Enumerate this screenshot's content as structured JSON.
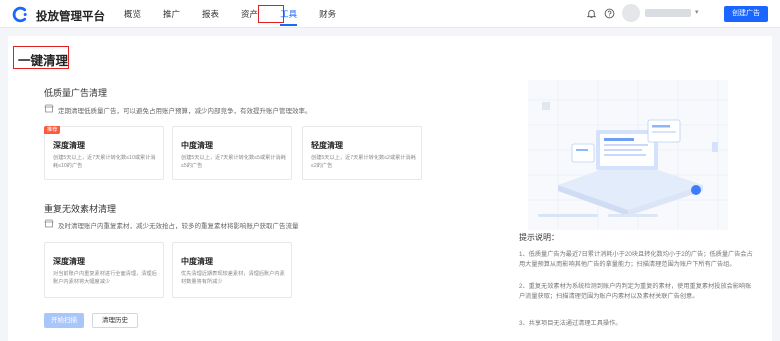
{
  "header": {
    "brand": "投放管理平台",
    "nav": [
      "概览",
      "推广",
      "报表",
      "资产",
      "工具",
      "财务"
    ],
    "active_nav": "工具",
    "icons": [
      "bell-icon",
      "help-icon"
    ],
    "create_button": "创建广告"
  },
  "page": {
    "title": "一键清理"
  },
  "low_quality": {
    "title": "低质量广告清理",
    "desc": "定期清理低质量广告，可以避免占用账户预算，减少内部竞争，有效提升账户管理效率。",
    "cards": [
      {
        "title": "深度清理",
        "badge": "推荐",
        "desc": "创建5天以上，近7天累计转化数≤10或累计消耗≤10的广告"
      },
      {
        "title": "中度清理",
        "desc": "创建5天以上，近7天累计转化数≤5或累计消耗≤5的广告"
      },
      {
        "title": "轻度清理",
        "desc": "创建5天以上，近7天累计转化数≤2或累计消耗≤2的广告"
      }
    ]
  },
  "duplicate": {
    "title": "重复无效素材清理",
    "desc": "及时清理账户内重复素材，减少无效抢占，较多的重复素材将影响账户获取广告流量",
    "cards": [
      {
        "title": "深度清理",
        "desc": "对当前账户内重复素材进行全面清理，清理后账户内素材将大幅度减少"
      },
      {
        "title": "中度清理",
        "desc": "优先清理近期表现较差素材，清理后账户内素材数量将有所减少"
      }
    ]
  },
  "actions": {
    "start": "开始扫描",
    "history": "清理历史"
  },
  "tips": {
    "title": "提示说明：",
    "items": [
      "1、低质量广告为最近7日累计消耗小于20块且转化数均小于2的广告；低质量广告会占用大量预算从而影响其他广告的拿量能力；扫描清理范围为账户下所有广告组。",
      "2、重复无效素材为系统检测到账户内判定为重复的素材，使用重复素材投放会影响账户流量获取；扫描清理范围为账户内素材以及素材关联广告创意。",
      "3、共享项目无法通过清理工具操作。"
    ]
  },
  "colors": {
    "accent": "#1a66ff",
    "highlight_box": "#e02020",
    "badge": "#ff5a3c"
  }
}
